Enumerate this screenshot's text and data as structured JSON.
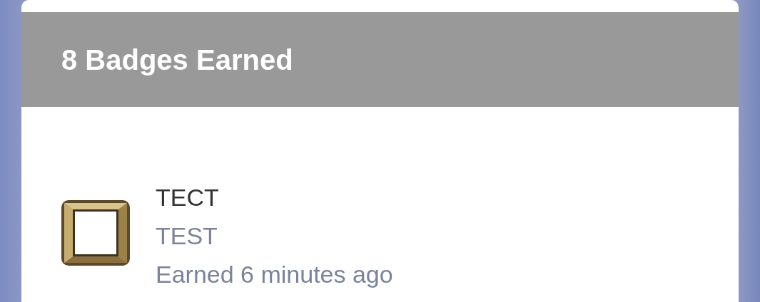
{
  "header": {
    "title": "8 Badges Earned"
  },
  "badges": [
    {
      "name": "TECT",
      "description": "TEST",
      "earned": "Earned 6 minutes ago"
    }
  ]
}
